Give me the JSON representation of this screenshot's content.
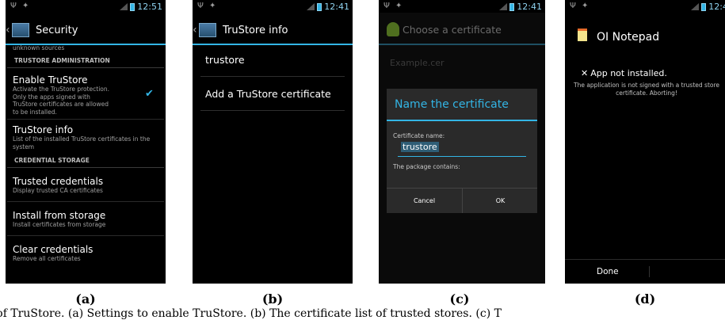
{
  "status": {
    "clock_a": "12:51",
    "clock_b": "12:41",
    "clock_c": "12:41",
    "clock_d": "12:4"
  },
  "panel_a": {
    "title": "Security",
    "partial_text": "unknown sources",
    "cat_admin": "TRUSTORE ADMINISTRATION",
    "enable_title": "Enable TruStore",
    "enable_summary": "Activate the TruStore protection. Only the apps signed with TruStore certificates are allowed to be installed.",
    "info_title": "TruStore info",
    "info_summary": "List of the installed TruStore certificates in the system",
    "cat_cred": "CREDENTIAL STORAGE",
    "trusted_title": "Trusted credentials",
    "trusted_summary": "Display trusted CA certificates",
    "install_title": "Install from storage",
    "install_summary": "Install certificates from storage",
    "clear_title": "Clear credentials",
    "clear_summary": "Remove all certificates"
  },
  "panel_b": {
    "title": "TruStore info",
    "item_1": "trustore",
    "item_2": "Add a TruStore certificate"
  },
  "panel_c": {
    "chooser_title": "Choose a certificate",
    "chooser_item": "Example.cer",
    "dialog_title": "Name the certificate",
    "name_label": "Certificate name:",
    "name_value": "trustore",
    "package_label": "The package contains:",
    "cancel": "Cancel",
    "ok": "OK"
  },
  "panel_d": {
    "title": "OI Notepad",
    "heading": "App not installed.",
    "message": "The application is not signed with a trusted store certificate. Aborting!",
    "done": "Done"
  },
  "labels": {
    "a": "(a)",
    "b": "(b)",
    "c": "(c)",
    "d": "(d)"
  },
  "caption": "ts of TruStore. (a) Settings to enable TruStore. (b) The certificate list of trusted stores. (c) T"
}
